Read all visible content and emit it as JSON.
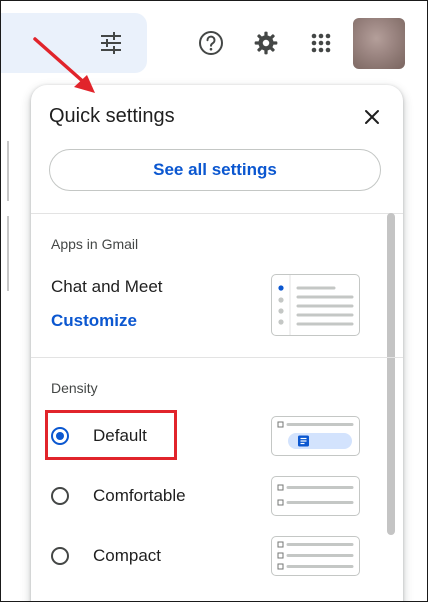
{
  "panel": {
    "title": "Quick settings",
    "see_all_label": "See all settings",
    "apps_section_label": "Apps in Gmail",
    "chat_meet_label": "Chat and Meet",
    "customize_label": "Customize",
    "density_section_label": "Density",
    "density_options": [
      {
        "label": "Default",
        "selected": true
      },
      {
        "label": "Comfortable",
        "selected": false
      },
      {
        "label": "Compact",
        "selected": false
      }
    ]
  },
  "icons": {
    "filter": "tune-icon",
    "help": "help-icon",
    "settings": "settings-gear-icon",
    "apps": "apps-grid-icon",
    "close": "close-icon"
  },
  "colors": {
    "accent": "#0b57d0",
    "annotation": "#e1242b",
    "toolbar_bg": "#eaf1fb"
  }
}
